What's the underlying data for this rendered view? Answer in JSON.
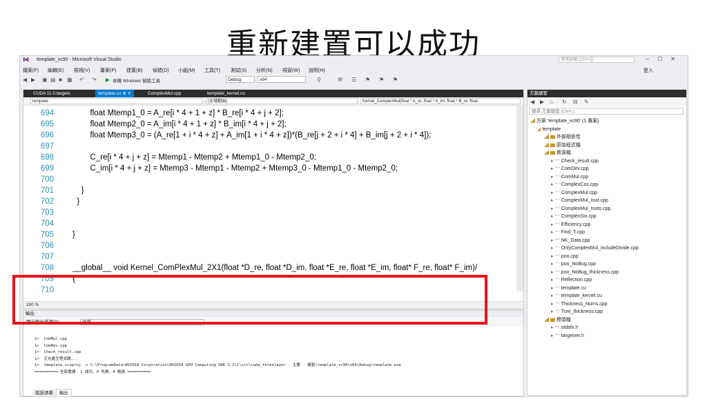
{
  "slide_title": "重新建置可以成功",
  "window": {
    "title": "template_vc90 - Microsoft Visual Studio",
    "quick_launch": "快速啟動 (Ctrl+Q)",
    "sign_in": "登入"
  },
  "menu": [
    "檔案(F)",
    "編輯(E)",
    "檢視(V)",
    "專案(P)",
    "建置(B)",
    "偵錯(D)",
    "小組(M)",
    "工具(T)",
    "測試(S)",
    "分析(N)",
    "視窗(W)",
    "說明(H)"
  ],
  "toolbar": {
    "debugger": "本機 Windows 偵錯工具",
    "config": "Debug",
    "platform": "x64"
  },
  "tabs": [
    {
      "label": "CUDA 11.0.targets",
      "active": false
    },
    {
      "label": "template.cu",
      "active": true
    },
    {
      "label": "ComplexMul.cpp",
      "active": false
    },
    {
      "label": "template_kernel.cu",
      "active": false
    }
  ],
  "navbar": {
    "project": "template",
    "scope": "(全域範圍)",
    "function": "Kernel_ComplexMul(float * A_re, float * A_im, float * B_re, float"
  },
  "code": [
    {
      "ln": "694",
      "text": "        float Mtemp1_0 = A_re[i * 4 + 1 + z] * B_re[i * 4 + j + 2];"
    },
    {
      "ln": "695",
      "text": "        float Mtemp2_0 = A_im[i * 4 + 1 + z] * B_im[i * 4 + j + 2];"
    },
    {
      "ln": "696",
      "text": "        float Mtemp3_0 = (A_re[1 + i * 4 + z] + A_im[1 + i * 4 + z])*(B_re[j + 2 + i * 4] + B_im[j + 2 + i * 4]);"
    },
    {
      "ln": "697",
      "text": ""
    },
    {
      "ln": "698",
      "text": "        C_re[i * 4 + j + z] = Mtemp1 - Mtemp2 + Mtemp1_0 - Mtemp2_0;"
    },
    {
      "ln": "699",
      "text": "        C_im[i * 4 + j + z] = Mtemp3 - Mtemp1 - Mtemp2 + Mtemp3_0 - Mtemp1_0 - Mtemp2_0;"
    },
    {
      "ln": "700",
      "text": ""
    },
    {
      "ln": "701",
      "text": "    }"
    },
    {
      "ln": "702",
      "text": "  }"
    },
    {
      "ln": "703",
      "text": ""
    },
    {
      "ln": "704",
      "text": ""
    },
    {
      "ln": "705",
      "text": "}"
    },
    {
      "ln": "706",
      "text": ""
    },
    {
      "ln": "707",
      "text": ""
    },
    {
      "ln": "708",
      "text": "__global__ void Kernel_ComPlexMul_2X1(float *D_re, float *D_im, float *E_re, float *E_im, float* F_re, float* F_im)/"
    },
    {
      "ln": "709",
      "text": "{"
    },
    {
      "ln": "710",
      "text": ""
    }
  ],
  "zoom": "100 %",
  "solution": {
    "panel_title": "方案總管",
    "search": "搜尋 方案總管 (Ctrl+;)",
    "items": [
      {
        "label": "方案 'template_vc90' (1 專案)",
        "indent": 0
      },
      {
        "label": "template",
        "indent": 1
      },
      {
        "label": "外部相依性",
        "indent": 2
      },
      {
        "label": "原始程式檔",
        "indent": 2
      },
      {
        "label": "資源檔",
        "indent": 2
      },
      {
        "label": "Check_result.cpp",
        "indent": 3
      },
      {
        "label": "ComDev.cpp",
        "indent": 3
      },
      {
        "label": "ComMul.cpp",
        "indent": 3
      },
      {
        "label": "ComplexCos.cpp",
        "indent": 3
      },
      {
        "label": "ComplexMul.cpp",
        "indent": 3
      },
      {
        "label": "ComplexMul_root.cpp",
        "indent": 3
      },
      {
        "label": "ComplexMul_roots.cpp",
        "indent": 3
      },
      {
        "label": "ComplexSin.cpp",
        "indent": 3
      },
      {
        "label": "Efficiency.cpp",
        "indent": 3
      },
      {
        "label": "Find_T.cpp",
        "indent": 3
      },
      {
        "label": "NK_Data.cpp",
        "indent": 3
      },
      {
        "label": "OnlyComplexMul_includeDivide.cpp",
        "indent": 3
      },
      {
        "label": "poo.cpp",
        "indent": 3
      },
      {
        "label": "poo_NoBug.cpp",
        "indent": 3
      },
      {
        "label": "poo_NoBug_thickness.cpp",
        "indent": 3
      },
      {
        "label": "Reflection.cpp",
        "indent": 3
      },
      {
        "label": "template.cu",
        "indent": 3
      },
      {
        "label": "template_kernel.cu",
        "indent": 3
      },
      {
        "label": "Thickness_Nums.cpp",
        "indent": 3
      },
      {
        "label": "Ture_thickness.cpp",
        "indent": 3
      },
      {
        "label": "標頭檔",
        "indent": 2
      },
      {
        "label": "stdafx.h",
        "indent": 3
      },
      {
        "label": "targetver.h",
        "indent": 3
      }
    ]
  },
  "output": {
    "title": "輸出",
    "source_label": "顯示輸出來源(S):",
    "source_value": "建置",
    "lines": [
      "1>  ComMul.cpp",
      "1>  ComDev.cpp",
      "1>  Check_result.cpp",
      "1>  正在產生程式碼...",
      "1>  template.vcxproj -> C:\\ProgramData\\NVIDIA Corporation\\NVIDIA GPU Computing SDK 3.2\\C\\src\\cuda_threelayer - 主要 - 複製\\template_vc90\\x64\\Debug\\template.exe",
      "========== 全部重建: 1 成功，0 失敗，0 略過 =========="
    ]
  },
  "bottom_tabs": [
    "錯誤清單",
    "輸出"
  ]
}
